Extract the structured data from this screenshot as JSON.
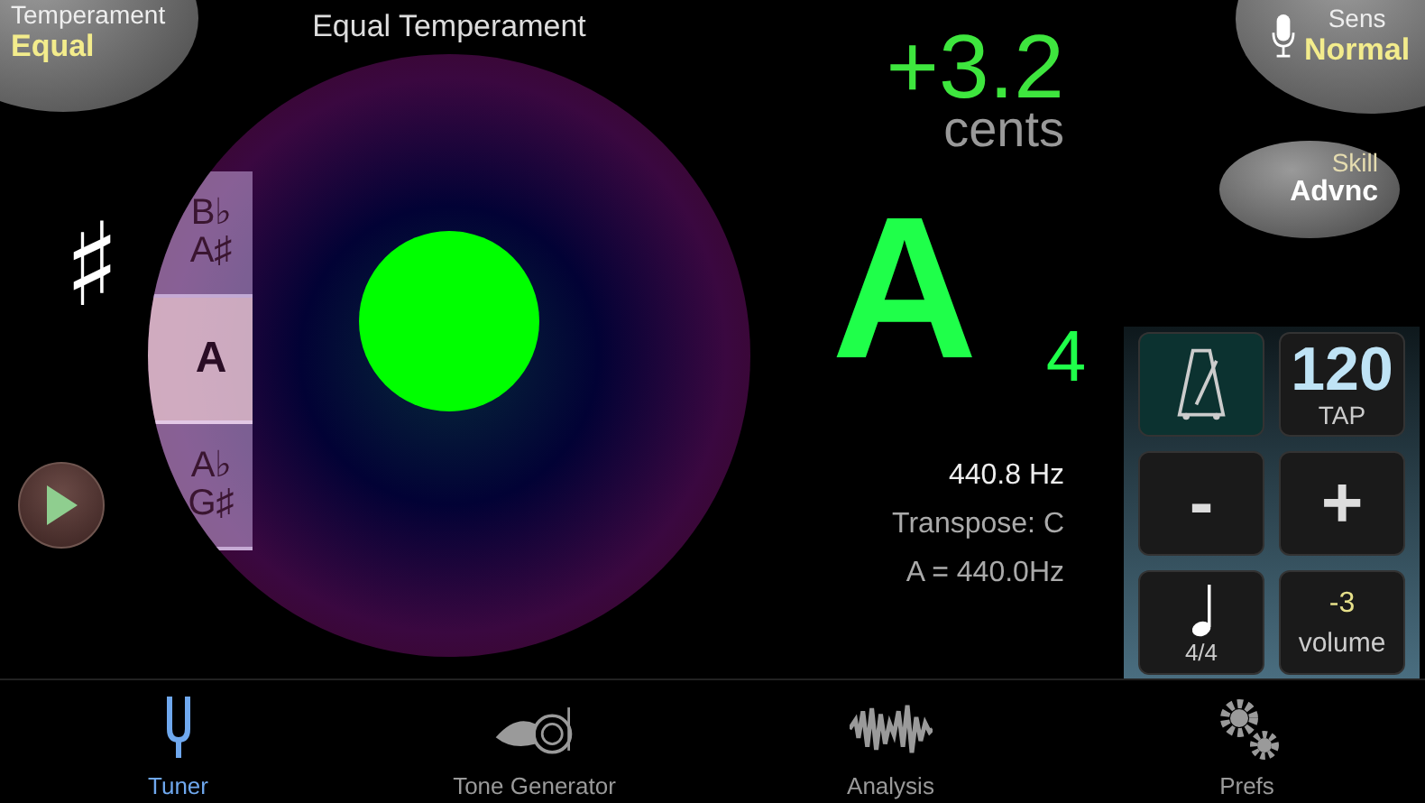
{
  "temperament_button": {
    "label": "Temperament",
    "value": "Equal"
  },
  "sensitivity_button": {
    "label": "Sens",
    "value": "Normal"
  },
  "skill_button": {
    "label": "Skill",
    "value": "Advnc"
  },
  "title": "Equal Temperament",
  "accidental": "♯",
  "note_wheel": [
    {
      "names": [
        "B♭",
        "A♯"
      ],
      "selected": false
    },
    {
      "names": [
        "A"
      ],
      "selected": true
    },
    {
      "names": [
        "A♭",
        "G♯"
      ],
      "selected": false
    }
  ],
  "reading": {
    "cents_value": "+3.2",
    "cents_unit": "cents",
    "note": "A",
    "octave": "4",
    "frequency": "440.8 Hz",
    "transpose": "Transpose: C",
    "reference": "A = 440.0Hz"
  },
  "metronome": {
    "on": true,
    "tempo": "120",
    "tap": "TAP",
    "minus": "-",
    "plus": "+",
    "meter": "4/4",
    "volume_value": "-3",
    "volume_label": "volume"
  },
  "tabs": [
    {
      "label": "Tuner",
      "kind": "fork",
      "selected": true
    },
    {
      "label": "Tone Generator",
      "kind": "horn",
      "selected": false
    },
    {
      "label": "Analysis",
      "kind": "wave",
      "selected": false
    },
    {
      "label": "Prefs",
      "kind": "gears",
      "selected": false
    }
  ]
}
